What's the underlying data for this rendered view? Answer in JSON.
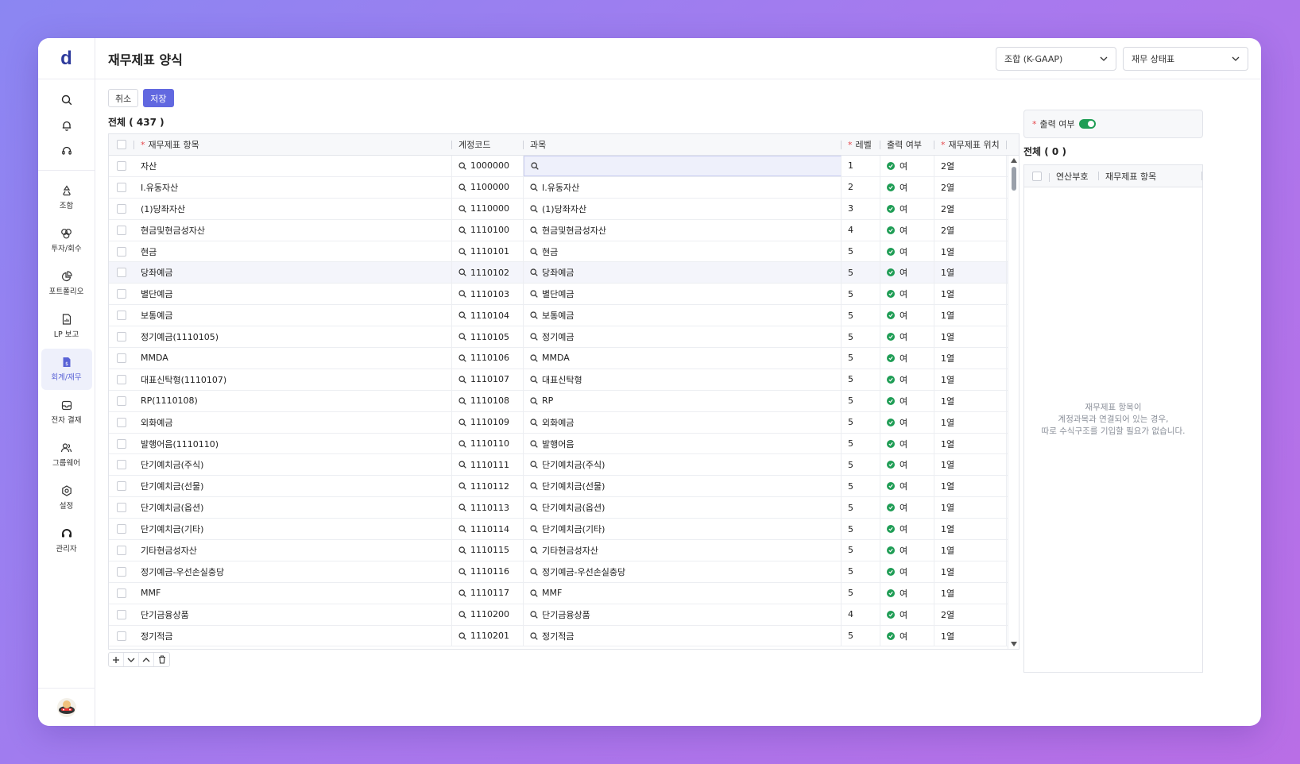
{
  "app": {
    "logo": "d"
  },
  "sidebar": {
    "items": [
      {
        "label": "조합",
        "icon": "recycle-icon"
      },
      {
        "label": "투자/회수",
        "icon": "coins-icon"
      },
      {
        "label": "포트폴리오",
        "icon": "pie-chart-icon"
      },
      {
        "label": "LP 보고",
        "icon": "report-icon"
      },
      {
        "label": "회계/재무",
        "icon": "accounting-icon"
      },
      {
        "label": "전자 결재",
        "icon": "inbox-icon"
      },
      {
        "label": "그룹웨어",
        "icon": "users-icon"
      },
      {
        "label": "설정",
        "icon": "settings-icon"
      },
      {
        "label": "관리자",
        "icon": "admin-headset-icon"
      }
    ],
    "active_index": 4
  },
  "header": {
    "title": "재무제표 양식",
    "select_fund": "조합 (K-GAAP)",
    "select_statement": "재무 상태표"
  },
  "toolbar": {
    "cancel": "취소",
    "save": "저장"
  },
  "grid": {
    "total_label": "전체 ( 437 )",
    "columns": {
      "item": "재무제표 항목",
      "code": "계정코드",
      "subject": "과목",
      "level": "레벨",
      "output": "출력 여부",
      "position": "재무제표 위치"
    },
    "rows": [
      {
        "item": "자산",
        "code": "1000000",
        "subject": "",
        "level": "1",
        "output": "여",
        "position": "2열"
      },
      {
        "item": "I.유동자산",
        "code": "1100000",
        "subject": "I.유동자산",
        "level": "2",
        "output": "여",
        "position": "2열"
      },
      {
        "item": "(1)당좌자산",
        "code": "1110000",
        "subject": "(1)당좌자산",
        "level": "3",
        "output": "여",
        "position": "2열"
      },
      {
        "item": "현금및현금성자산",
        "code": "1110100",
        "subject": "현금및현금성자산",
        "level": "4",
        "output": "여",
        "position": "2열"
      },
      {
        "item": "현금",
        "code": "1110101",
        "subject": "현금",
        "level": "5",
        "output": "여",
        "position": "1열"
      },
      {
        "item": "당좌예금",
        "code": "1110102",
        "subject": "당좌예금",
        "level": "5",
        "output": "여",
        "position": "1열"
      },
      {
        "item": "별단예금",
        "code": "1110103",
        "subject": "별단예금",
        "level": "5",
        "output": "여",
        "position": "1열"
      },
      {
        "item": "보통예금",
        "code": "1110104",
        "subject": "보통예금",
        "level": "5",
        "output": "여",
        "position": "1열"
      },
      {
        "item": "정기예금(1110105)",
        "code": "1110105",
        "subject": "정기예금",
        "level": "5",
        "output": "여",
        "position": "1열"
      },
      {
        "item": "MMDA",
        "code": "1110106",
        "subject": "MMDA",
        "level": "5",
        "output": "여",
        "position": "1열"
      },
      {
        "item": "대표신탁형(1110107)",
        "code": "1110107",
        "subject": "대표신탁형",
        "level": "5",
        "output": "여",
        "position": "1열"
      },
      {
        "item": "RP(1110108)",
        "code": "1110108",
        "subject": "RP",
        "level": "5",
        "output": "여",
        "position": "1열"
      },
      {
        "item": "외화예금",
        "code": "1110109",
        "subject": "외화예금",
        "level": "5",
        "output": "여",
        "position": "1열"
      },
      {
        "item": "발행어음(1110110)",
        "code": "1110110",
        "subject": "발행어음",
        "level": "5",
        "output": "여",
        "position": "1열"
      },
      {
        "item": "단기예치금(주식)",
        "code": "1110111",
        "subject": "단기예치금(주식)",
        "level": "5",
        "output": "여",
        "position": "1열"
      },
      {
        "item": "단기예치금(선물)",
        "code": "1110112",
        "subject": "단기예치금(선물)",
        "level": "5",
        "output": "여",
        "position": "1열"
      },
      {
        "item": "단기예치금(옵션)",
        "code": "1110113",
        "subject": "단기예치금(옵션)",
        "level": "5",
        "output": "여",
        "position": "1열"
      },
      {
        "item": "단기예치금(기타)",
        "code": "1110114",
        "subject": "단기예치금(기타)",
        "level": "5",
        "output": "여",
        "position": "1열"
      },
      {
        "item": "기타현금성자산",
        "code": "1110115",
        "subject": "기타현금성자산",
        "level": "5",
        "output": "여",
        "position": "1열"
      },
      {
        "item": "정기예금-우선손실충당",
        "code": "1110116",
        "subject": "정기예금-우선손실충당",
        "level": "5",
        "output": "여",
        "position": "1열"
      },
      {
        "item": "MMF",
        "code": "1110117",
        "subject": "MMF",
        "level": "5",
        "output": "여",
        "position": "1열"
      },
      {
        "item": "단기금융상품",
        "code": "1110200",
        "subject": "단기금융상품",
        "level": "4",
        "output": "여",
        "position": "2열"
      },
      {
        "item": "정기적금",
        "code": "1110201",
        "subject": "정기적금",
        "level": "5",
        "output": "여",
        "position": "1열"
      }
    ]
  },
  "right_panel": {
    "output_label": "출력 여부",
    "output_on": true,
    "total_label": "전체 ( 0 )",
    "columns": {
      "op": "연산부호",
      "item": "재무제표 항목"
    },
    "empty_lines": [
      "재무제표 항목이",
      "계정과목과 연결되어 있는 경우,",
      "따로 수식구조를 기입할 필요가 없습니다."
    ]
  },
  "colors": {
    "accent": "#6168e0",
    "success": "#1f9d55",
    "required": "#e5484d"
  }
}
